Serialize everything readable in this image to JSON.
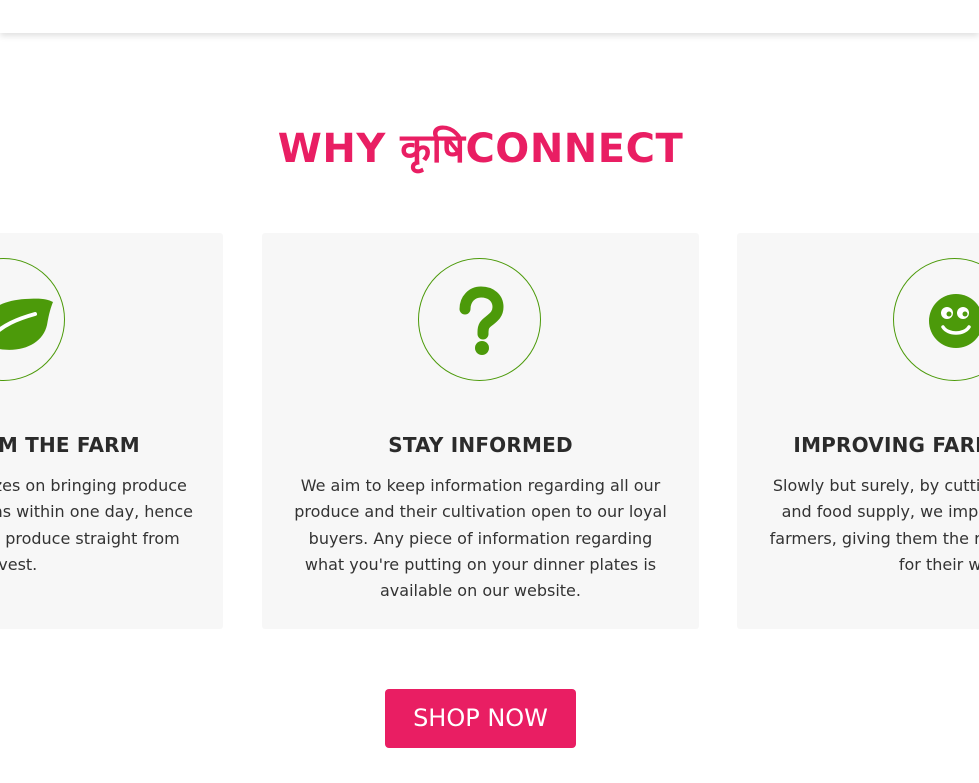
{
  "section": {
    "title": "WHY कृषिCONNECT"
  },
  "features": [
    {
      "icon": "leaf-icon",
      "title": "FRESH FROM THE FARM",
      "text": "Our concept emphasizes on bringing produce directly from local farms within one day, hence ensuring the freshest produce straight from harvest."
    },
    {
      "icon": "question-mark-icon",
      "title": "STAY INFORMED",
      "text": "We aim to keep information regarding all our produce and their cultivation open to our loyal buyers. Any piece of information regarding what you're putting on your dinner plates is available on our website."
    },
    {
      "icon": "smiley-face-icon",
      "title": "IMPROVING FARMERS' LIVES",
      "text": "Slowly but surely, by cutting the supply chain and food supply, we improve the welfare of farmers, giving them the returns they deserve for their work."
    }
  ],
  "cta": {
    "label": "SHOP NOW"
  },
  "colors": {
    "accent": "#e91e63",
    "icon_green": "#4c9a0a",
    "card_bg": "#f7f7f7"
  }
}
